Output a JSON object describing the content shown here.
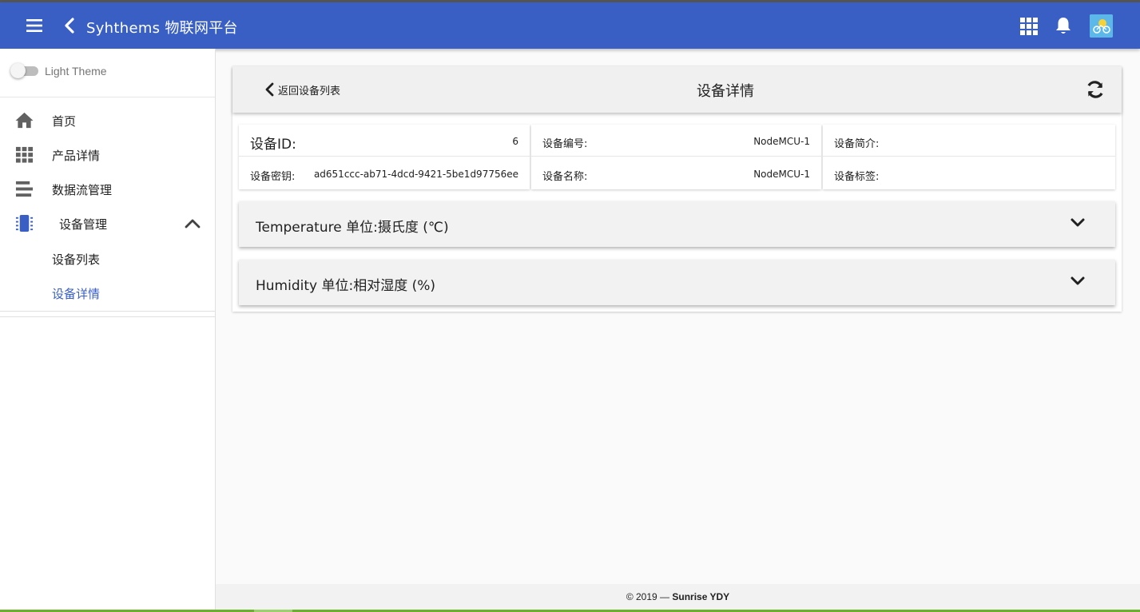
{
  "app": {
    "title": "Syhthems 物联网平台",
    "brand_color": "#3a5fc4",
    "avatar_color": "#5bb8e8"
  },
  "drawer": {
    "theme_toggle_label": "Light Theme",
    "theme_toggle_on": false,
    "items": [
      {
        "label": "首页",
        "icon": "home-icon"
      },
      {
        "label": "产品详情",
        "icon": "grid-icon"
      },
      {
        "label": "数据流管理",
        "icon": "lines-icon"
      },
      {
        "label": "设备管理",
        "icon": "chip-icon",
        "expanded": true,
        "children": [
          {
            "label": "设备列表",
            "active": false
          },
          {
            "label": "设备详情",
            "active": true
          }
        ]
      }
    ],
    "active_color": "#3a5fc4"
  },
  "device_card": {
    "back_label": "返回设备列表",
    "title": "设备详情",
    "fields": {
      "id_label": "设备ID:",
      "id_value": "6",
      "secret_label": "设备密钥:",
      "secret_value": "ad651ccc-ab71-4dcd-9421-5be1d97756ee",
      "code_label": "设备编号:",
      "code_value": "NodeMCU-1",
      "name_label": "设备名称:",
      "name_value": "NodeMCU-1",
      "desc_label": "设备简介:",
      "desc_value": "",
      "tag_label": "设备标签:",
      "tag_value": ""
    },
    "panels": [
      {
        "title": "Temperature 单位:摄氏度 (℃)"
      },
      {
        "title": "Humidity 单位:相对湿度 (%)"
      }
    ]
  },
  "footer": {
    "copyright": "© 2019 — ",
    "author": "Sunrise YDY"
  }
}
